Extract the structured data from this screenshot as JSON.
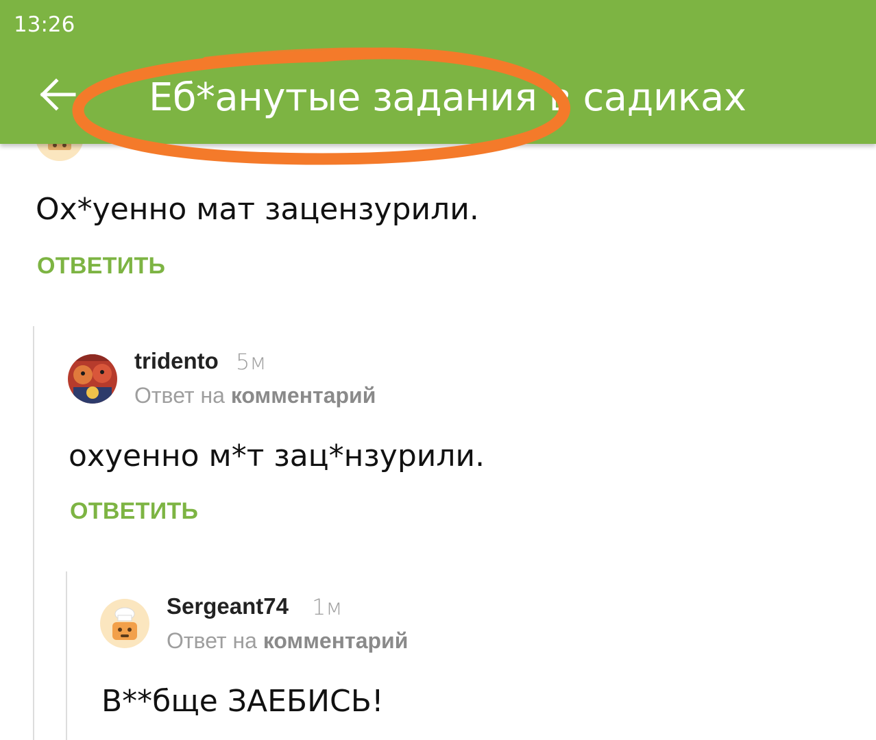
{
  "status_bar": {
    "time": "13:26"
  },
  "app_bar": {
    "title": "Еб*анутые задания в садиках",
    "back_icon": "arrow-left-icon",
    "background_color": "#7db443"
  },
  "annotation": {
    "shape": "ellipse",
    "color": "#f47a2a"
  },
  "comments": [
    {
      "text": "Ох*уенно мат зацензурили.",
      "reply_label": "ОТВЕТИТЬ"
    },
    {
      "username": "tridento",
      "time": "5м",
      "reply_prefix": "Ответ на ",
      "reply_target": "комментарий",
      "text": "охуенно м*т зац*нзурили.",
      "reply_label": "ОТВЕТИТЬ"
    },
    {
      "username": "Sergeant74",
      "time": "1м",
      "reply_prefix": "Ответ на ",
      "reply_target": "комментарий",
      "text": "В**бще ЗАЕБИСЬ!"
    }
  ],
  "colors": {
    "accent": "#7db443",
    "annotation": "#f47a2a",
    "muted_text": "#9e9e9e"
  }
}
